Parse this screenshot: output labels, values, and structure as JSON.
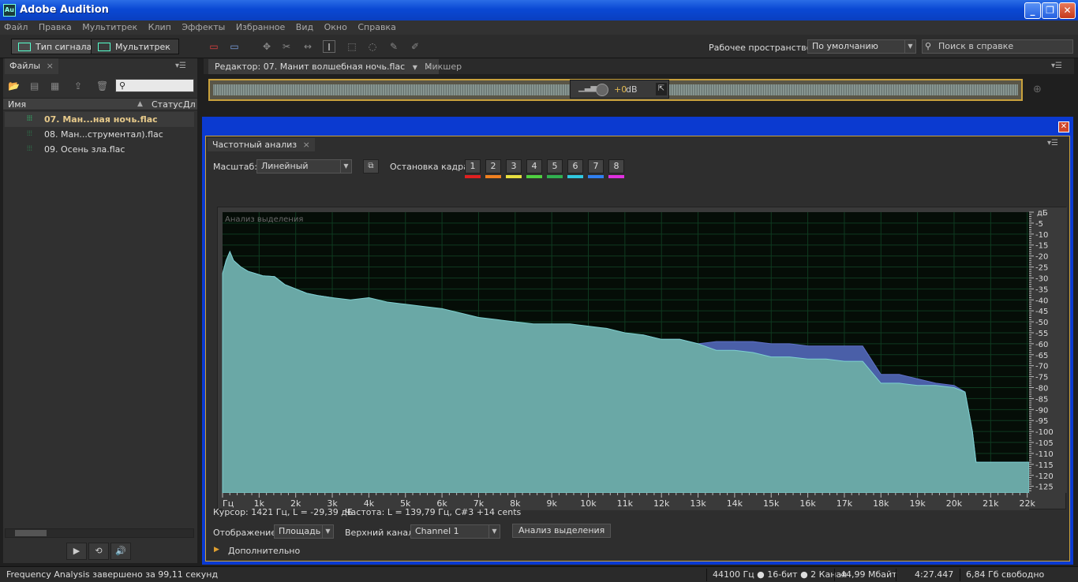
{
  "app": {
    "title": "Adobe Audition",
    "icon_text": "Au"
  },
  "menu": [
    "Файл",
    "Правка",
    "Мультитрек",
    "Клип",
    "Эффекты",
    "Избранное",
    "Вид",
    "Окно",
    "Справка"
  ],
  "toolbar": {
    "waveform_label": "Тип сигнала",
    "multitrack_label": "Мультитрек",
    "workspace_label": "Рабочее пространство:",
    "workspace_value": "По умолчанию",
    "help_search_placeholder": "Поиск в справке"
  },
  "files_panel": {
    "tab_label": "Файлы",
    "columns": {
      "name": "Имя",
      "status": "Статус",
      "duration": "Дл"
    },
    "items": [
      {
        "label": "07. Ман...ная ночь.flac",
        "selected": true
      },
      {
        "label": "08. Ман...струментал).flac",
        "selected": false
      },
      {
        "label": "09. Осень зла.flac",
        "selected": false
      }
    ]
  },
  "editor": {
    "tab_label": "Редактор: 07. Манит волшебная ночь.flac",
    "mixer_label": "Микшер",
    "hud_value": "+0",
    "hud_unit": "dB"
  },
  "freq_analysis": {
    "tab_label": "Частотный анализ",
    "scale_label": "Масштаб:",
    "scale_value": "Линейный",
    "freeze_label": "Остановка кадра:",
    "frames": [
      {
        "label": "1",
        "color": "#e02020"
      },
      {
        "label": "2",
        "color": "#f08020"
      },
      {
        "label": "3",
        "color": "#e8e040"
      },
      {
        "label": "4",
        "color": "#50d040"
      },
      {
        "label": "5",
        "color": "#30b050"
      },
      {
        "label": "6",
        "color": "#30c8e0"
      },
      {
        "label": "7",
        "color": "#3080f0"
      },
      {
        "label": "8",
        "color": "#e030e0"
      }
    ],
    "plot_caption": "Анализ выделения",
    "cursor_text": "Курсор: 1421 Гц, L = -29,39 дБ",
    "freq_text": "Частота: L = 139,79 Гц, C#3 +14 cents",
    "display_label": "Отображение:",
    "display_value": "Площадь",
    "channel_label": "Верхний канал:",
    "channel_value": "Channel 1",
    "analyze_button": "Анализ выделения",
    "advanced_label": "Дополнительно"
  },
  "chart_data": {
    "type": "area",
    "xlabel": "Гц",
    "ylabel": "дБ",
    "xlim": [
      0,
      22050
    ],
    "ylim": [
      -128,
      0
    ],
    "x_ticks": [
      "1k",
      "2k",
      "3k",
      "4k",
      "5k",
      "6k",
      "7k",
      "8k",
      "9k",
      "10k",
      "11k",
      "12k",
      "13k",
      "14k",
      "15k",
      "16k",
      "17k",
      "18k",
      "19k",
      "20k",
      "21k",
      "22k"
    ],
    "y_ticks": [
      "-5",
      "-10",
      "-15",
      "-20",
      "-25",
      "-30",
      "-35",
      "-40",
      "-45",
      "-50",
      "-55",
      "-60",
      "-65",
      "-70",
      "-75",
      "-80",
      "-85",
      "-90",
      "-95",
      "-100",
      "-105",
      "-110",
      "-115",
      "-120",
      "-125"
    ],
    "grid": true,
    "x": [
      0,
      100,
      200,
      300,
      500,
      700,
      900,
      1100,
      1421,
      1700,
      2000,
      2300,
      2600,
      3000,
      3500,
      4000,
      4500,
      5000,
      5500,
      6000,
      6500,
      7000,
      7500,
      8000,
      8500,
      9000,
      9500,
      10000,
      10500,
      11000,
      11500,
      12000,
      12500,
      13000,
      13500,
      14000,
      14500,
      15000,
      15500,
      16000,
      16500,
      17000,
      17500,
      18000,
      18500,
      19000,
      19500,
      20000,
      20300,
      20500,
      20600,
      21000,
      21500,
      22050
    ],
    "series": [
      {
        "values": [
          -28,
          -22,
          -18,
          -22,
          -25,
          -27,
          -28,
          -29,
          -29.4,
          -33,
          -35,
          -37,
          -38,
          -39,
          -41,
          -41,
          -43,
          -45,
          -46,
          -47,
          -49,
          -51,
          -52,
          -53,
          -54,
          -54,
          -54,
          -55,
          -55,
          -56,
          -56,
          -58,
          -58,
          -60,
          -63,
          -63,
          -64,
          -66,
          -66,
          -67,
          -67,
          -68,
          -68,
          -78,
          -78,
          -79,
          -79,
          -80,
          -82,
          -100,
          -114,
          -114,
          -114,
          -114
        ]
      },
      {
        "values": [
          -28,
          -22,
          -18,
          -22,
          -25,
          -27,
          -28,
          -29,
          -29.4,
          -33,
          -35,
          -37,
          -38,
          -39,
          -41,
          -41,
          -43,
          -45,
          -46,
          -47,
          -49,
          -51,
          -52,
          -53,
          -54,
          -54,
          -54,
          -55,
          -55,
          -56,
          -56,
          -58,
          -58,
          -60,
          -59,
          -59,
          -59,
          -60,
          -60,
          -61,
          -61,
          -61,
          -61,
          -74,
          -74,
          -76,
          -78,
          -79,
          -82,
          -100,
          -114,
          -114,
          -114,
          -114
        ]
      },
      {
        "values": [
          -28,
          -22,
          -18,
          -22,
          -25,
          -27,
          -28,
          -29,
          -29.4,
          -33,
          -35,
          -37,
          -38,
          -39,
          -40,
          -39,
          -41,
          -42,
          -43,
          -44,
          -46,
          -48,
          -49,
          -50,
          -51,
          -51,
          -51,
          -52,
          -53,
          -55,
          -56,
          -58,
          -58,
          -60,
          -63,
          -63,
          -64,
          -66,
          -66,
          -67,
          -67,
          -68,
          -68,
          -78,
          -78,
          -79,
          -79,
          -80,
          -82,
          -100,
          -114,
          -114,
          -114,
          -114
        ]
      }
    ]
  },
  "status": {
    "message": "Frequency Analysis завершено за 99,11 секунд",
    "format": "44100 Гц ● 16-бит ● 2 Канал",
    "size": "44,99 Мбайт",
    "duration": "4:27.447",
    "free": "6,84 Гб свободно"
  }
}
